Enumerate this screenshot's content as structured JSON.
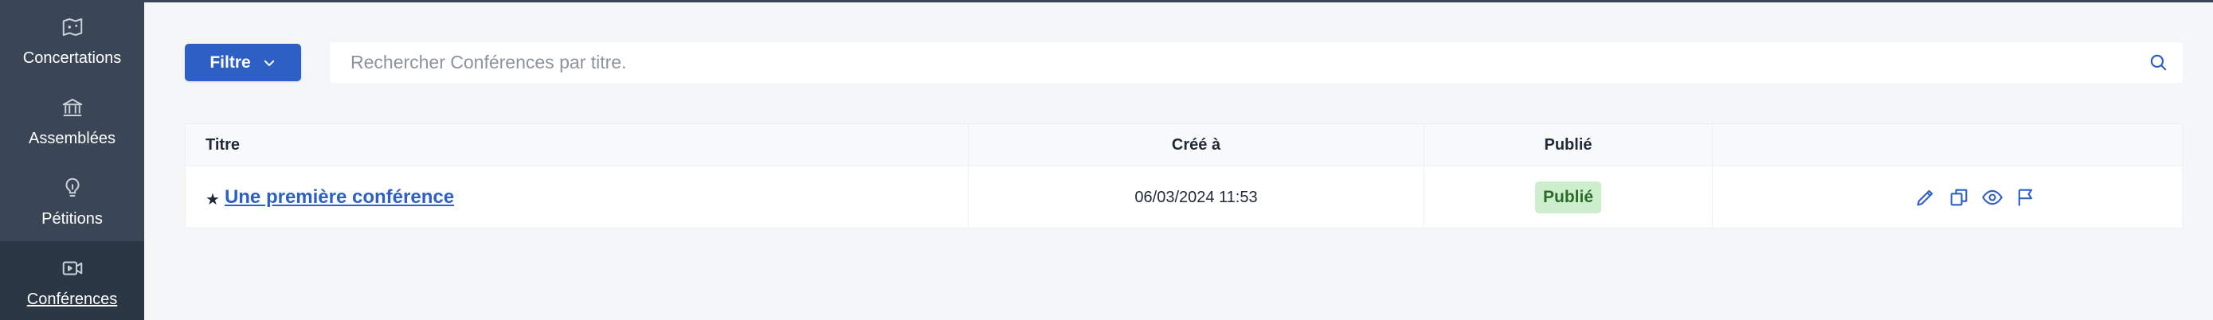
{
  "sidebar": {
    "items": [
      {
        "label": "Concertations",
        "icon": "map-icon",
        "active": false
      },
      {
        "label": "Assemblées",
        "icon": "institution-icon",
        "active": false
      },
      {
        "label": "Pétitions",
        "icon": "lightbulb-icon",
        "active": false
      },
      {
        "label": "Conférences",
        "icon": "video-icon",
        "active": true
      }
    ]
  },
  "toolbar": {
    "filter_label": "Filtre",
    "search_placeholder": "Rechercher Conférences par titre."
  },
  "table": {
    "columns": [
      "Titre",
      "Créé à",
      "Publié",
      ""
    ],
    "rows": [
      {
        "title": "Une première conférence",
        "created_at": "06/03/2024 11:53",
        "published": "Publié",
        "starred": true,
        "actions": [
          "pencil-icon",
          "copy-icon",
          "eye-icon",
          "flag-icon"
        ]
      }
    ]
  },
  "colors": {
    "sidebar_bg": "#3a4656",
    "sidebar_active_bg": "#2c3745",
    "primary": "#2d5fc4",
    "badge_bg": "#cdeecd",
    "badge_text": "#2b6a2b",
    "page_bg": "#f5f6f8"
  }
}
